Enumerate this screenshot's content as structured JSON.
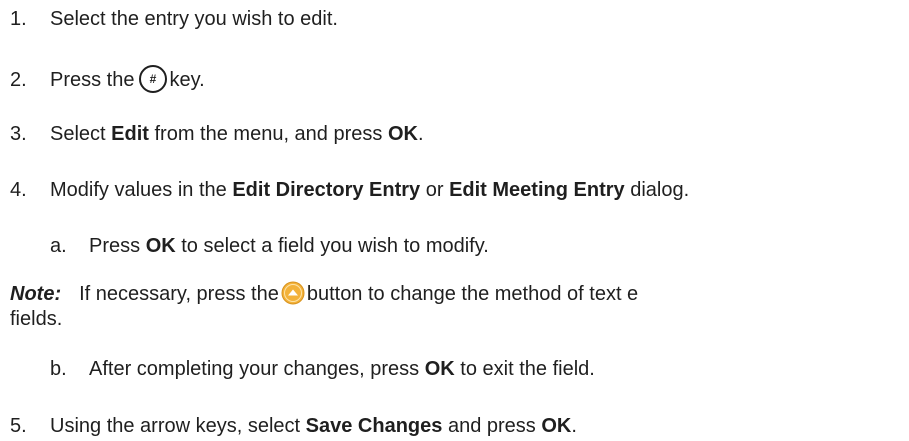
{
  "steps": [
    {
      "number": "1.",
      "text": "Select the entry you wish to edit."
    },
    {
      "number": "2.",
      "before": "Press the",
      "key_symbol": "#",
      "key_icon": "hash-key-icon",
      "after": "key."
    },
    {
      "number": "3.",
      "t1": "Select ",
      "b1": "Edit",
      "t2": " from the menu, and press ",
      "b2": "OK",
      "t3": "."
    },
    {
      "number": "4.",
      "t1": "Modify values in the ",
      "b1": "Edit Directory Entry",
      "t2": " or ",
      "b2": "Edit Meeting Entry",
      "t3": " dialog.",
      "substeps": [
        {
          "letter": "a.",
          "t1": "Press ",
          "b1": "OK",
          "t2": " to select a field you wish to modify."
        },
        {
          "letter": "b.",
          "t1": "After completing your changes, press ",
          "b1": "OK",
          "t2": " to exit the field."
        }
      ],
      "note": {
        "label": "Note:",
        "before": "If necessary, press the",
        "icon": "up-arrow-button-icon",
        "icon_color": "#f3b23a",
        "after": "button to change the method of text e",
        "continuation": "fields."
      }
    },
    {
      "number": "5.",
      "t1": "Using the arrow keys, select ",
      "b1": "Save Changes",
      "t2": " and press ",
      "b2": "OK",
      "t3": "."
    }
  ]
}
